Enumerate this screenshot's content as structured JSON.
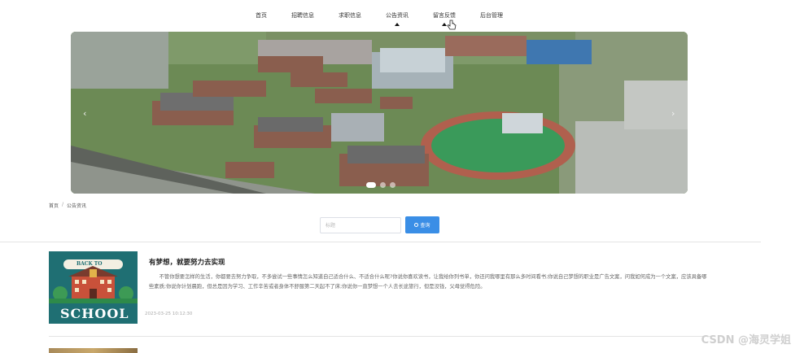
{
  "nav": {
    "items": [
      "首页",
      "招聘信息",
      "求职信息",
      "公告资讯",
      "留言反馈",
      "后台管理"
    ]
  },
  "banner": {
    "prev_arrow": "‹",
    "next_arrow": "›",
    "slide_count": 3,
    "active_slide": 1
  },
  "breadcrumb": {
    "home": "首页",
    "separator": "/",
    "current": "公告资讯"
  },
  "search": {
    "placeholder": "标题",
    "button_label": "查询"
  },
  "news": [
    {
      "title": "有梦想，就要努力去实现",
      "summary": "不管你想要怎样的生活，你都要去努力争取，不多尝试一些事情怎么知道自己适合什么、不适合什么呢?你说你喜欢读书，让我给你列书单，你还问我哪里有那么多时间看书;你说自己梦想的职业是广告文案，问我如何成为一个文案，应该具备哪些素质;你说你计划晨跑，但总是因为学习、工作辛苦或者身体不舒服第二天起不了床;你说你一直梦想一个人去长途旅行，但是没钱，父母觉得危险。",
      "date": "2023-03-25 10:12:30",
      "thumb_caption": "SCHOOL",
      "thumb_top": "BACK TO"
    }
  ],
  "watermark": "CSDN @海灵学姐",
  "colors": {
    "primary": "#3a8ee6",
    "thumb_bg": "#1f6f73"
  }
}
